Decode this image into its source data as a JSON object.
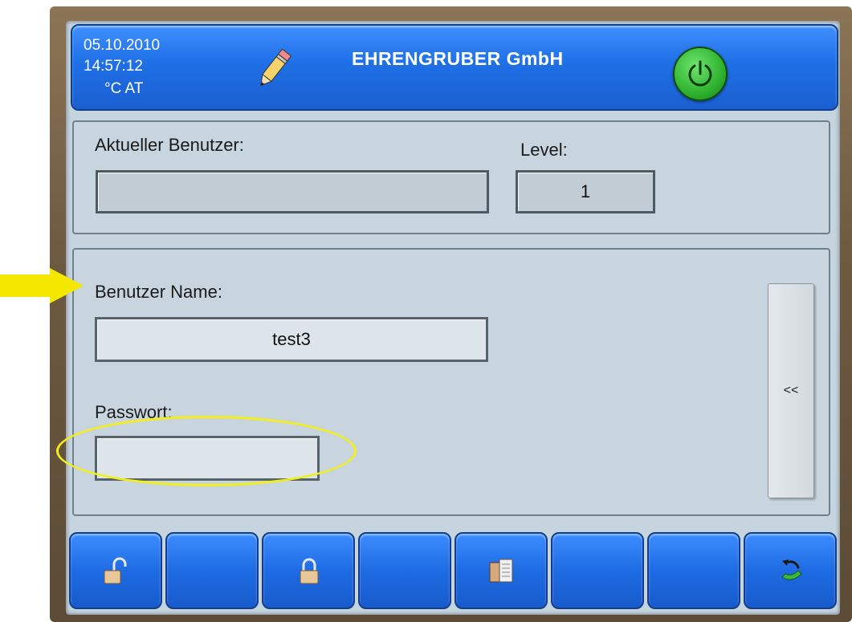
{
  "header": {
    "date": "05.10.2010",
    "time": "14:57:12",
    "unit": "°C  AT",
    "title": "EHRENGRUBER GmbH",
    "accent_color": "#1f6fe6",
    "power_button_color": "#2fb32f",
    "icons": [
      "pencil-icon",
      "power-icon"
    ]
  },
  "current_user": {
    "label": "Aktueller Benutzer:",
    "value": "",
    "level_label": "Level:",
    "level_value": "1"
  },
  "login": {
    "username_label": "Benutzer Name:",
    "username_value": "test3",
    "password_label": "Passwort:",
    "password_value": "",
    "side_button_label": "<<"
  },
  "toolbar": {
    "buttons": [
      {
        "icon": "unlock-icon"
      },
      {
        "icon": ""
      },
      {
        "icon": "lock-icon"
      },
      {
        "icon": ""
      },
      {
        "icon": "folder-icon"
      },
      {
        "icon": ""
      },
      {
        "icon": ""
      },
      {
        "icon": "exit-icon"
      }
    ]
  },
  "annotations": {
    "highlight_color": "#f5e800"
  }
}
